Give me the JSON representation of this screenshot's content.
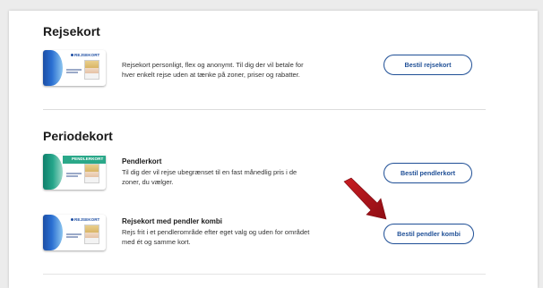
{
  "sections": {
    "rejsekort": {
      "heading": "Rejsekort",
      "items": [
        {
          "card_brand": "REJSEKORT",
          "description_line1": "Rejsekort personligt, flex og anonymt. Til dig der vil betale for",
          "description_line2": "hver enkelt rejse uden at tænke på zoner, priser og rabatter.",
          "button_label": "Bestil rejsekort"
        }
      ]
    },
    "periodekort": {
      "heading": "Periodekort",
      "items": [
        {
          "card_brand": "PENDLERKORT",
          "title": "Pendlerkort",
          "description_line1": "Til dig der vil rejse ubegrænset til en fast månedlig pris i de",
          "description_line2": "zoner, du vælger.",
          "button_label": "Bestil pendlerkort"
        },
        {
          "card_brand": "REJSEKORT",
          "title": "Rejsekort med pendler kombi",
          "description_line1": "Rejs frit i et pendlerområde efter eget valg og uden for området",
          "description_line2": "med ét og samme kort.",
          "button_label": "Bestil pendler kombi"
        }
      ]
    }
  },
  "colors": {
    "accent": "#1f4f96",
    "arrow": "#b0121b",
    "background": "#ececec"
  }
}
